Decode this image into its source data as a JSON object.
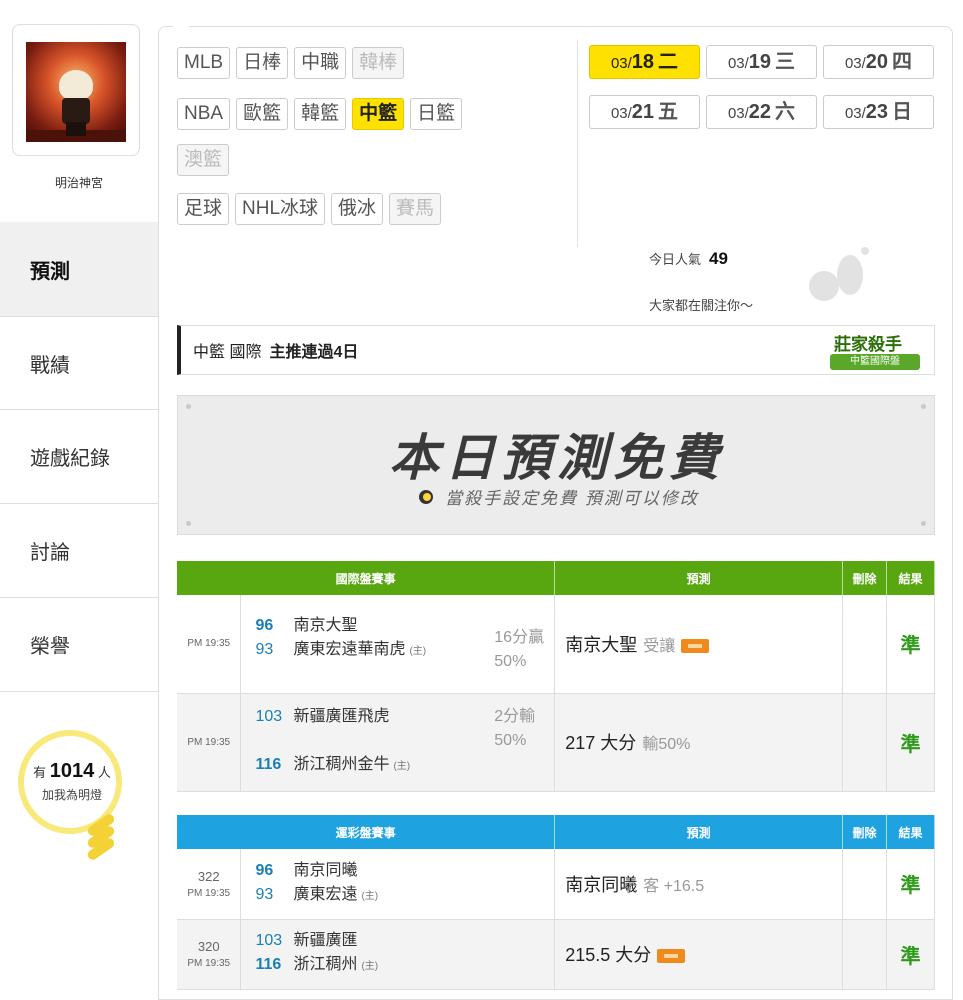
{
  "user": {
    "name": "明治神宮"
  },
  "nav": {
    "predict": "預測",
    "record": "戰績",
    "games": "遊戲紀錄",
    "discuss": "討論",
    "honor": "榮譽"
  },
  "fans": {
    "prefix": "有",
    "count": "1014",
    "suffix": "人",
    "sub": "加我為明燈"
  },
  "leagues": [
    [
      "MLB",
      "日棒",
      "中職",
      "韓棒"
    ],
    [
      "NBA",
      "歐籃",
      "韓籃",
      "中籃",
      "日籃"
    ],
    [
      "澳籃"
    ],
    [
      "足球",
      "NHL冰球",
      "俄冰",
      "賽馬"
    ]
  ],
  "dates": [
    {
      "md": "03/",
      "day": "18",
      "wd": "二"
    },
    {
      "md": "03/",
      "day": "19",
      "wd": "三"
    },
    {
      "md": "03/",
      "day": "20",
      "wd": "四"
    },
    {
      "md": "03/",
      "day": "21",
      "wd": "五"
    },
    {
      "md": "03/",
      "day": "22",
      "wd": "六"
    },
    {
      "md": "03/",
      "day": "23",
      "wd": "日"
    }
  ],
  "popularity": {
    "label": "今日人氣",
    "value": "49",
    "attention": "大家都在關注你～"
  },
  "streak": {
    "league": "中籃 國際",
    "text": "主推連過4日"
  },
  "badge": {
    "title": "莊家殺手",
    "ribbon": "中籃國際盤"
  },
  "banner": {
    "title": "本日預測免費",
    "subtitle": "當殺手設定免費 預測可以修改"
  },
  "international": {
    "headers": [
      "國際盤賽事",
      "預測",
      "刪除",
      "結果"
    ],
    "rows": [
      {
        "time": "PM 19:35",
        "away_score": "96",
        "away": "南京大聖",
        "home_score": "93",
        "home": "廣東宏遠華南虎",
        "home_mark": "(主)",
        "spread": "16分贏",
        "spread_pct": "50%",
        "pick": "南京大聖",
        "pick_note": "受讓",
        "result": "準"
      },
      {
        "time": "PM 19:35",
        "away_score": "103",
        "away": "新疆廣匯飛虎",
        "home_score": "116",
        "home": "浙江稠州金牛",
        "home_mark": "(主)",
        "spread": "2分輸",
        "spread_pct": "50%",
        "pick": "217 大分",
        "pick_note": "輸50%",
        "result": "準"
      }
    ]
  },
  "lottery": {
    "headers": [
      "運彩盤賽事",
      "預測",
      "刪除",
      "結果"
    ],
    "rows": [
      {
        "code": "322",
        "time": "PM 19:35",
        "away_score": "96",
        "away": "南京同曦",
        "home_score": "93",
        "home": "廣東宏遠",
        "home_mark": "(主)",
        "pick": "南京同曦",
        "pick_note": "客 +16.5",
        "result": "準"
      },
      {
        "code": "320",
        "time": "PM 19:35",
        "away_score": "103",
        "away": "新疆廣匯",
        "home_score": "116",
        "home": "浙江稠州",
        "home_mark": "(主)",
        "pick": "215.5 大分",
        "pick_note": "",
        "result": "準"
      }
    ]
  },
  "colors": {
    "active": "#ffe100",
    "green_header": "#58a610",
    "blue_header": "#1fa3e0",
    "result": "#2e9a1a"
  }
}
